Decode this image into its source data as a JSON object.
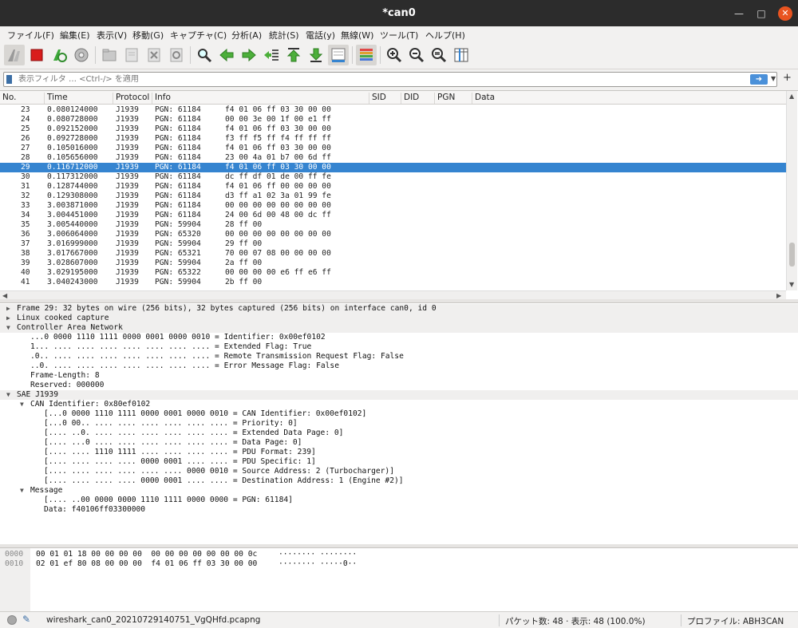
{
  "window": {
    "title": "*can0"
  },
  "menu": [
    "ファイル(F)",
    "編集(E)",
    "表示(V)",
    "移動(G)",
    "キャプチャ(C)",
    "分析(A)",
    "統計(S)",
    "電話(y)",
    "無線(W)",
    "ツール(T)",
    "ヘルプ(H)"
  ],
  "filter": {
    "placeholder": "表示フィルタ … <Ctrl-/> を適用",
    "apply_icon": "arrow-right-icon"
  },
  "packet_list": {
    "columns": [
      "No.",
      "Time",
      "Protocol",
      "Info",
      "SID",
      "DID",
      "PGN",
      "Data"
    ],
    "selected_no": "29",
    "rows": [
      {
        "no": "23",
        "time": "0.080124000",
        "proto": "J1939",
        "pgn": "PGN: 61184",
        "data": "f4 01 06 ff 03 30 00 00"
      },
      {
        "no": "24",
        "time": "0.080728000",
        "proto": "J1939",
        "pgn": "PGN: 61184",
        "data": "00 00 3e 00 1f 00 e1 ff"
      },
      {
        "no": "25",
        "time": "0.092152000",
        "proto": "J1939",
        "pgn": "PGN: 61184",
        "data": "f4 01 06 ff 03 30 00 00"
      },
      {
        "no": "26",
        "time": "0.092728000",
        "proto": "J1939",
        "pgn": "PGN: 61184",
        "data": "f3 ff f5 ff f4 ff ff ff"
      },
      {
        "no": "27",
        "time": "0.105016000",
        "proto": "J1939",
        "pgn": "PGN: 61184",
        "data": "f4 01 06 ff 03 30 00 00"
      },
      {
        "no": "28",
        "time": "0.105656000",
        "proto": "J1939",
        "pgn": "PGN: 61184",
        "data": "23 00 4a 01 b7 00 6d ff"
      },
      {
        "no": "29",
        "time": "0.116712000",
        "proto": "J1939",
        "pgn": "PGN: 61184",
        "data": "f4 01 06 ff 03 30 00 00"
      },
      {
        "no": "30",
        "time": "0.117312000",
        "proto": "J1939",
        "pgn": "PGN: 61184",
        "data": "dc ff df 01 de 00 ff fe"
      },
      {
        "no": "31",
        "time": "0.128744000",
        "proto": "J1939",
        "pgn": "PGN: 61184",
        "data": "f4 01 06 ff 00 00 00 00"
      },
      {
        "no": "32",
        "time": "0.129308000",
        "proto": "J1939",
        "pgn": "PGN: 61184",
        "data": "d3 ff a1 02 3a 01 99 fe"
      },
      {
        "no": "33",
        "time": "3.003871000",
        "proto": "J1939",
        "pgn": "PGN: 61184",
        "data": "00 00 00 00 00 00 00 00"
      },
      {
        "no": "34",
        "time": "3.004451000",
        "proto": "J1939",
        "pgn": "PGN: 61184",
        "data": "24 00 6d 00 48 00 dc ff"
      },
      {
        "no": "35",
        "time": "3.005440000",
        "proto": "J1939",
        "pgn": "PGN: 59904",
        "data": "28 ff 00"
      },
      {
        "no": "36",
        "time": "3.006064000",
        "proto": "J1939",
        "pgn": "PGN: 65320",
        "data": "00 00 00 00 00 00 00 00"
      },
      {
        "no": "37",
        "time": "3.016999000",
        "proto": "J1939",
        "pgn": "PGN: 59904",
        "data": "29 ff 00"
      },
      {
        "no": "38",
        "time": "3.017667000",
        "proto": "J1939",
        "pgn": "PGN: 65321",
        "data": "70 00 07 08 00 00 00 00"
      },
      {
        "no": "39",
        "time": "3.028607000",
        "proto": "J1939",
        "pgn": "PGN: 59904",
        "data": "2a ff 00"
      },
      {
        "no": "40",
        "time": "3.029195000",
        "proto": "J1939",
        "pgn": "PGN: 65322",
        "data": "00 00 00 00 e6 ff e6 ff"
      },
      {
        "no": "41",
        "time": "3.040243000",
        "proto": "J1939",
        "pgn": "PGN: 59904",
        "data": "2b ff 00"
      }
    ]
  },
  "details": [
    {
      "text": "Frame 29: 32 bytes on wire (256 bits), 32 bytes captured (256 bits) on interface can0, id 0",
      "indent": 0,
      "twisty": "closed",
      "hdr": true
    },
    {
      "text": "Linux cooked capture",
      "indent": 0,
      "twisty": "closed",
      "hdr": true
    },
    {
      "text": "Controller Area Network",
      "indent": 0,
      "twisty": "open",
      "hdr": true
    },
    {
      "text": "...0 0000 1110 1111 0000 0001 0000 0010 = Identifier: 0x00ef0102",
      "indent": 1,
      "twisty": "",
      "hdr": false
    },
    {
      "text": "1... .... .... .... .... .... .... .... = Extended Flag: True",
      "indent": 1,
      "twisty": "",
      "hdr": false
    },
    {
      "text": ".0.. .... .... .... .... .... .... .... = Remote Transmission Request Flag: False",
      "indent": 1,
      "twisty": "",
      "hdr": false
    },
    {
      "text": "..0. .... .... .... .... .... .... .... = Error Message Flag: False",
      "indent": 1,
      "twisty": "",
      "hdr": false
    },
    {
      "text": "Frame-Length: 8",
      "indent": 1,
      "twisty": "",
      "hdr": false
    },
    {
      "text": "Reserved: 000000",
      "indent": 1,
      "twisty": "",
      "hdr": false
    },
    {
      "text": "SAE J1939",
      "indent": 0,
      "twisty": "open",
      "hdr": true
    },
    {
      "text": "CAN Identifier: 0x80ef0102",
      "indent": 1,
      "twisty": "open",
      "hdr": false
    },
    {
      "text": "[...0 0000 1110 1111 0000 0001 0000 0010 = CAN Identifier: 0x00ef0102]",
      "indent": 2,
      "twisty": "",
      "hdr": false
    },
    {
      "text": "[...0 00.. .... .... .... .... .... .... = Priority: 0]",
      "indent": 2,
      "twisty": "",
      "hdr": false
    },
    {
      "text": "[.... ..0. .... .... .... .... .... .... = Extended Data Page: 0]",
      "indent": 2,
      "twisty": "",
      "hdr": false
    },
    {
      "text": "[.... ...0 .... .... .... .... .... .... = Data Page: 0]",
      "indent": 2,
      "twisty": "",
      "hdr": false
    },
    {
      "text": "[.... .... 1110 1111 .... .... .... .... = PDU Format: 239]",
      "indent": 2,
      "twisty": "",
      "hdr": false
    },
    {
      "text": "[.... .... .... .... 0000 0001 .... .... = PDU Specific: 1]",
      "indent": 2,
      "twisty": "",
      "hdr": false
    },
    {
      "text": "[.... .... .... .... .... .... 0000 0010 = Source Address: 2 (Turbocharger)]",
      "indent": 2,
      "twisty": "",
      "hdr": false
    },
    {
      "text": "[.... .... .... .... 0000 0001 .... .... = Destination Address: 1 (Engine #2)]",
      "indent": 2,
      "twisty": "",
      "hdr": false
    },
    {
      "text": "Message",
      "indent": 1,
      "twisty": "open",
      "hdr": false
    },
    {
      "text": "[.... ..00 0000 0000 1110 1111 0000 0000 = PGN: 61184]",
      "indent": 2,
      "twisty": "",
      "hdr": false
    },
    {
      "text": "Data: f40106ff03300000",
      "indent": 2,
      "twisty": "",
      "hdr": false
    }
  ],
  "bytes": [
    {
      "offset": "0000",
      "hex": "00 01 01 18 00 00 00 00  00 00 00 00 00 00 00 0c",
      "ascii": "········ ········"
    },
    {
      "offset": "0010",
      "hex": "02 01 ef 80 08 00 00 00  f4 01 06 ff 03 30 00 00",
      "ascii": "········ ·····0··"
    }
  ],
  "status": {
    "file": "wireshark_can0_20210729140751_VgQHfd.pcapng",
    "packets": "パケット数: 48 · 表示: 48 (100.0%)",
    "profile": "プロファイル: ABH3CAN"
  }
}
